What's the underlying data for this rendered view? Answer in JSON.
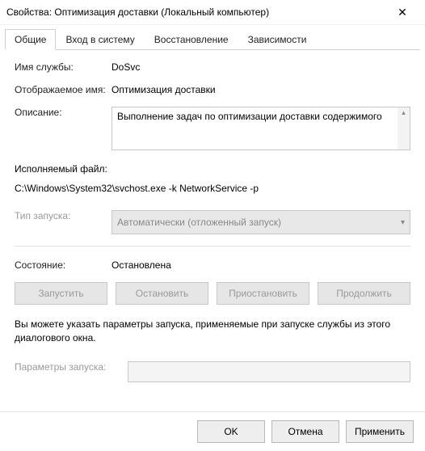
{
  "titlebar": {
    "title": "Свойства: Оптимизация доставки (Локальный компьютер)"
  },
  "tabs": {
    "general": "Общие",
    "logon": "Вход в систему",
    "recovery": "Восстановление",
    "deps": "Зависимости"
  },
  "labels": {
    "service_name": "Имя службы:",
    "display_name": "Отображаемое имя:",
    "description": "Описание:",
    "exe_path": "Исполняемый файл:",
    "startup_type": "Тип запуска:",
    "state": "Состояние:",
    "start_params": "Параметры запуска:"
  },
  "values": {
    "service_name": "DoSvc",
    "display_name": "Оптимизация доставки",
    "description": "Выполнение задач по оптимизации доставки содержимого",
    "exe_path": "C:\\Windows\\System32\\svchost.exe -k NetworkService -p",
    "startup_type": "Автоматически (отложенный запуск)",
    "state": "Остановлена",
    "start_params": ""
  },
  "buttons": {
    "start": "Запустить",
    "stop": "Остановить",
    "pause": "Приостановить",
    "resume": "Продолжить"
  },
  "note": "Вы можете указать параметры запуска, применяемые при запуске службы из этого диалогового окна.",
  "footer": {
    "ok": "OK",
    "cancel": "Отмена",
    "apply": "Применить"
  }
}
